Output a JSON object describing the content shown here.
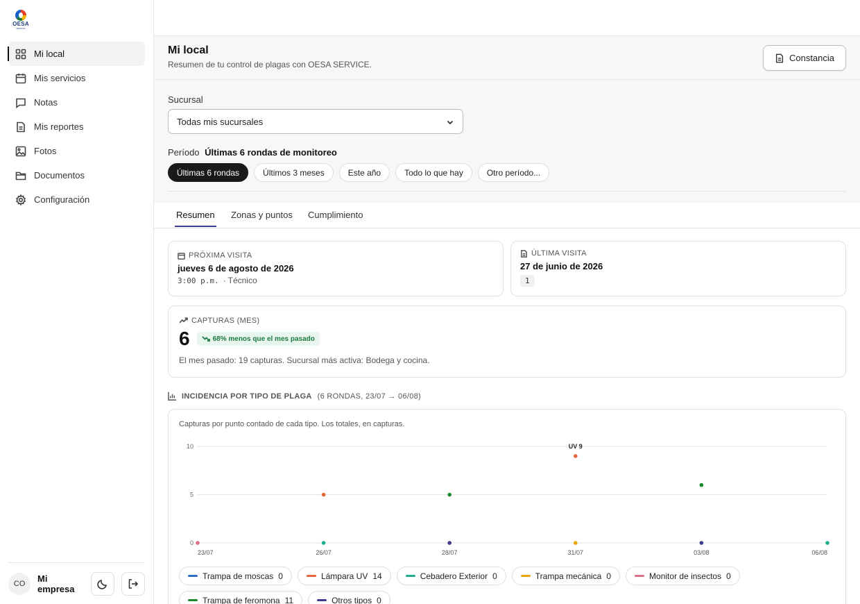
{
  "brand": {
    "name": "OESA",
    "tagline": "SERVICE"
  },
  "sidebar": {
    "items": [
      {
        "label": "Mi local",
        "icon": "dashboard-icon",
        "active": true
      },
      {
        "label": "Mis servicios",
        "icon": "calendar-icon"
      },
      {
        "label": "Notas",
        "icon": "message-icon"
      },
      {
        "label": "Mis reportes",
        "icon": "report-icon"
      },
      {
        "label": "Fotos",
        "icon": "image-icon"
      },
      {
        "label": "Documentos",
        "icon": "folder-icon"
      },
      {
        "label": "Configuración",
        "icon": "gear-icon"
      }
    ],
    "footer": {
      "avatar": "CO",
      "company": "Mi empresa",
      "theme_icon": "moon-icon",
      "logout_icon": "logout-icon"
    }
  },
  "header": {
    "title": "Mi local",
    "subtitle": "Resumen de tu control de plagas con OESA SERVICE.",
    "button_label": "Constancia"
  },
  "filters": {
    "branch_label": "Sucursal",
    "branch_value": "Todas mis sucursales",
    "period_label": "Período",
    "period_value": "Últimas 6 rondas de monitoreo",
    "chips": [
      "Últimas 6 rondas",
      "Últimos 3 meses",
      "Este año",
      "Todo lo que hay",
      "Otro período..."
    ],
    "active_chip": 0
  },
  "tabs": [
    "Resumen",
    "Zonas y puntos",
    "Cumplimiento"
  ],
  "next_visit": {
    "label": "PRÓXIMA VISITA",
    "date": "jueves 6 de agosto de 2026",
    "time": "3:00 p.m.",
    "sep": "·",
    "role": "Técnico"
  },
  "last_visit": {
    "label": "ÚLTIMA VISITA",
    "date": "27 de junio de 2026",
    "count": "1"
  },
  "captures": {
    "label": "CAPTURAS (MES)",
    "value": "6",
    "trend": "68% menos que el mes pasado",
    "note": "El mes pasado: 19 capturas. Sucursal más activa: Bodega y cocina."
  },
  "incidence": {
    "title": "INCIDENCIA POR TIPO DE PLAGA",
    "range": "(6 RONDAS, 23/07 → 06/08)",
    "caption": "Capturas por punto contado de cada tipo. Los totales, en capturas."
  },
  "colors": {
    "moscas": "#2f6fd0",
    "uv": "#e8643a",
    "cebadero": "#1fae8c",
    "mecanica": "#e8a50f",
    "monitor": "#e0708a",
    "feromona": "#1a8a2e",
    "otros": "#3c3a8e"
  },
  "chart_data": {
    "type": "scatter",
    "x": [
      "23/07",
      "26/07",
      "28/07",
      "31/07",
      "03/08",
      "06/08"
    ],
    "ylim": [
      0,
      10
    ],
    "yticks": [
      0,
      5,
      10
    ],
    "grid": true,
    "series": [
      {
        "name": "Trampa de moscas",
        "total": "0",
        "color_key": "moscas",
        "values": []
      },
      {
        "name": "Lámpara UV",
        "total": "14",
        "color_key": "uv",
        "values": [
          {
            "x": "26/07",
            "y": 5
          },
          {
            "x": "31/07",
            "y": 9
          }
        ]
      },
      {
        "name": "Cebadero Exterior",
        "total": "0",
        "color_key": "cebadero",
        "values": [
          {
            "x": "26/07",
            "y": 0
          },
          {
            "x": "06/08",
            "y": 0
          }
        ]
      },
      {
        "name": "Trampa mecánica",
        "total": "0",
        "color_key": "mecanica",
        "values": [
          {
            "x": "31/07",
            "y": 0
          }
        ]
      },
      {
        "name": "Monitor de insectos",
        "total": "0",
        "color_key": "monitor",
        "values": [
          {
            "x": "23/07",
            "y": 0
          }
        ]
      },
      {
        "name": "Trampa de feromona",
        "total": "11",
        "color_key": "feromona",
        "values": [
          {
            "x": "28/07",
            "y": 5
          },
          {
            "x": "03/08",
            "y": 6
          }
        ]
      },
      {
        "name": "Otros tipos",
        "total": "0",
        "color_key": "otros",
        "values": [
          {
            "x": "28/07",
            "y": 0
          },
          {
            "x": "03/08",
            "y": 0
          }
        ]
      }
    ],
    "annotations": [
      {
        "x": "31/07",
        "text": "UV 9"
      }
    ]
  }
}
